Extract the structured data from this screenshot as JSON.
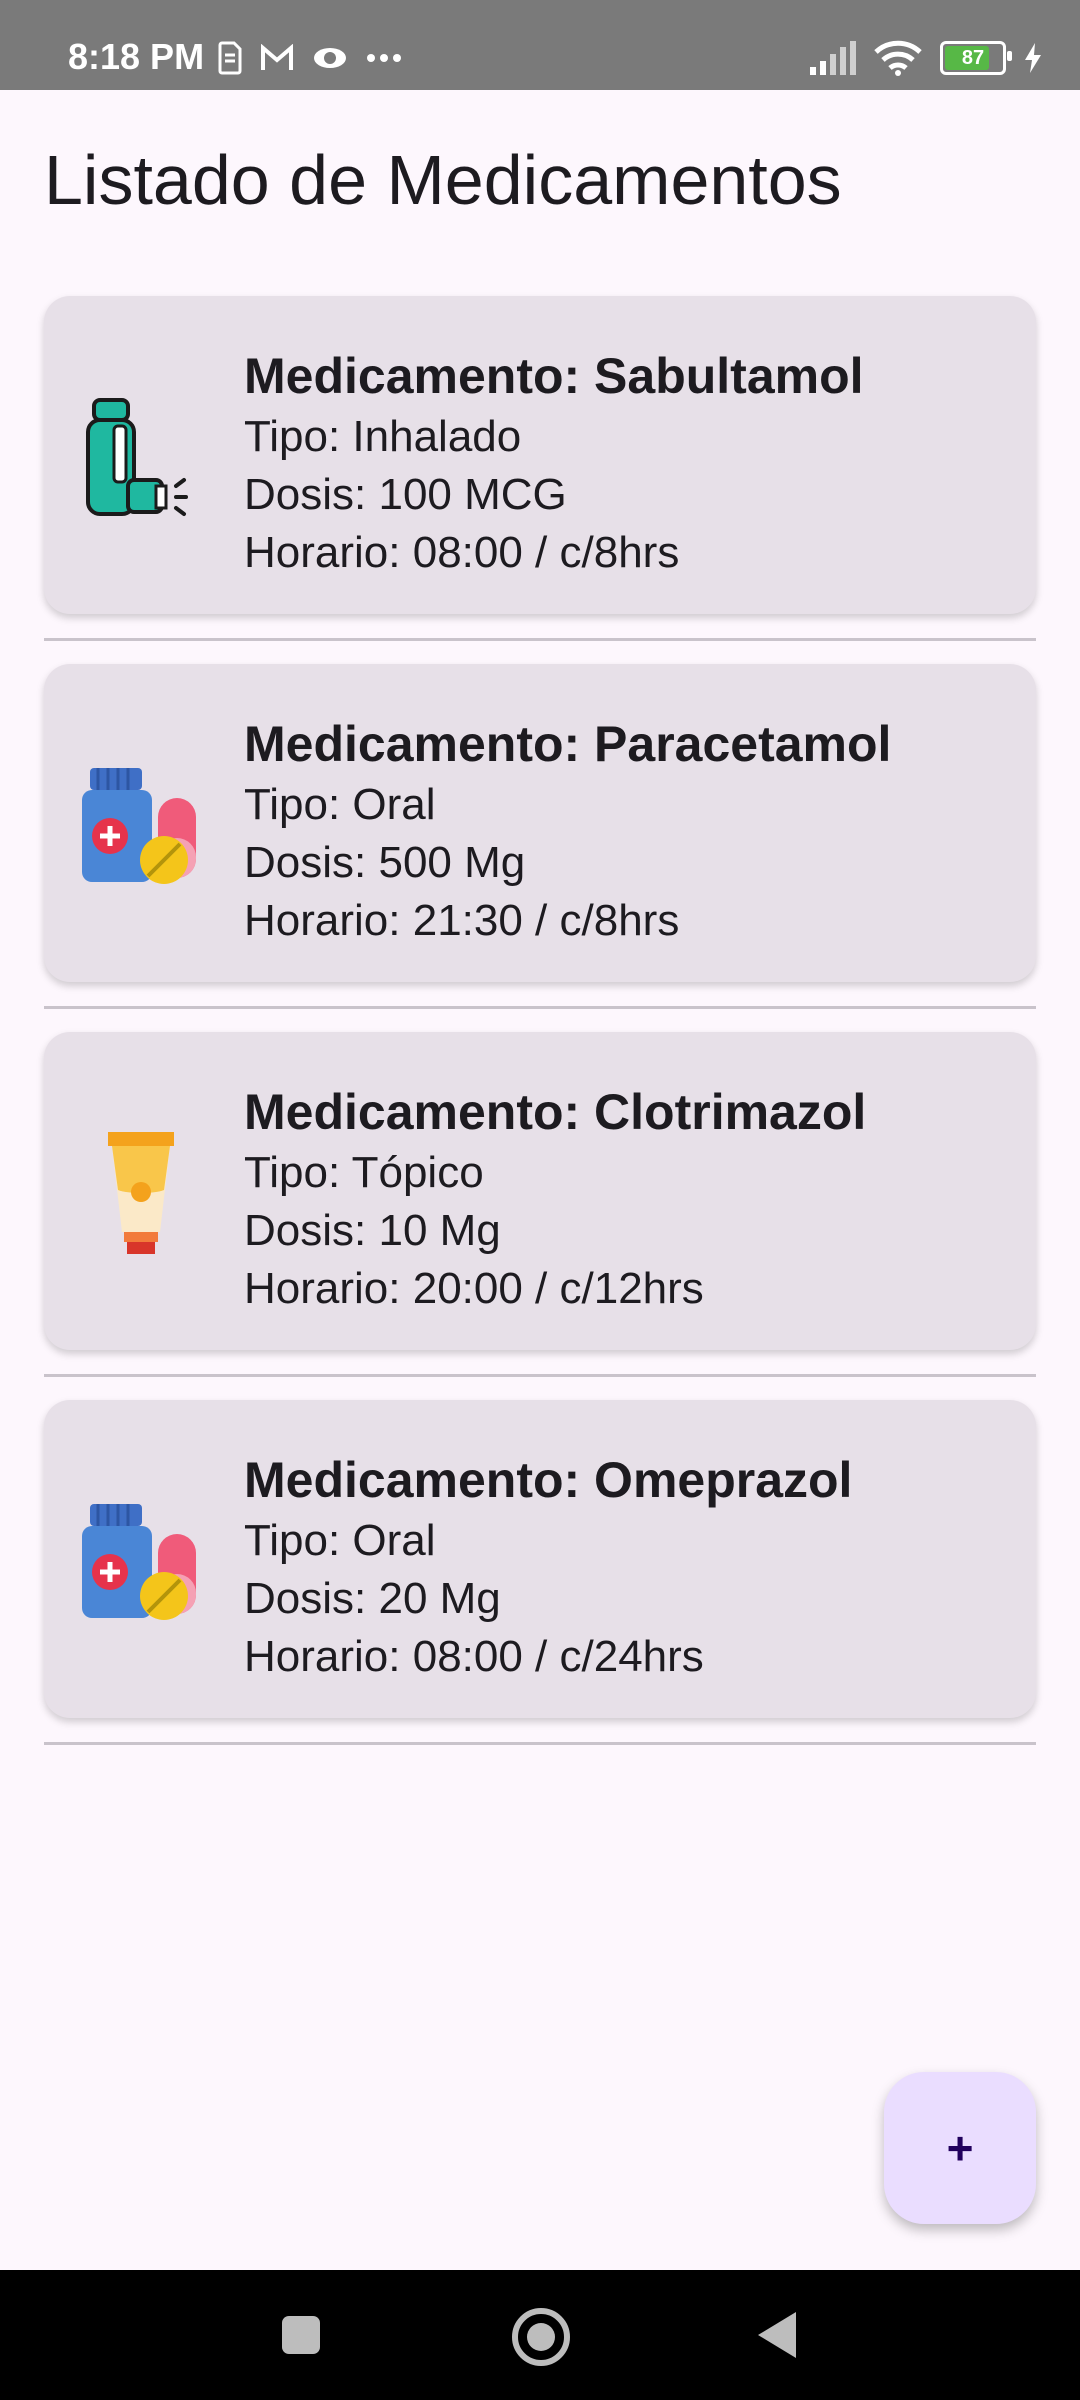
{
  "status_bar": {
    "time": "8:18 PM",
    "left_icons": [
      "sim-icon",
      "gmail-icon",
      "eye-icon",
      "more-dots-icon"
    ],
    "battery": "87"
  },
  "page": {
    "title": "Listado de Medicamentos"
  },
  "medications": [
    {
      "name": "Medicamento: Sabultamol",
      "type": "Tipo: Inhalado",
      "dose": "Dosis: 100 MCG",
      "schedule": "Horario: 08:00 / c/8hrs",
      "icon": "inhaler-icon"
    },
    {
      "name": "Medicamento: Paracetamol",
      "type": "Tipo: Oral",
      "dose": "Dosis: 500 Mg",
      "schedule": "Horario: 21:30 / c/8hrs",
      "icon": "pills-bottle-icon"
    },
    {
      "name": "Medicamento: Clotrimazol",
      "type": "Tipo: Tópico",
      "dose": "Dosis: 10 Mg",
      "schedule": "Horario: 20:00 / c/12hrs",
      "icon": "ointment-tube-icon"
    },
    {
      "name": "Medicamento: Omeprazol",
      "type": "Tipo: Oral",
      "dose": "Dosis: 20 Mg",
      "schedule": "Horario: 08:00 / c/24hrs",
      "icon": "pills-bottle-icon"
    }
  ],
  "fab": {
    "label": "+"
  },
  "colors": {
    "background": "#fdf7fd",
    "card": "#e7e0e8",
    "fab": "#eaddff",
    "fab_text": "#21005d"
  }
}
